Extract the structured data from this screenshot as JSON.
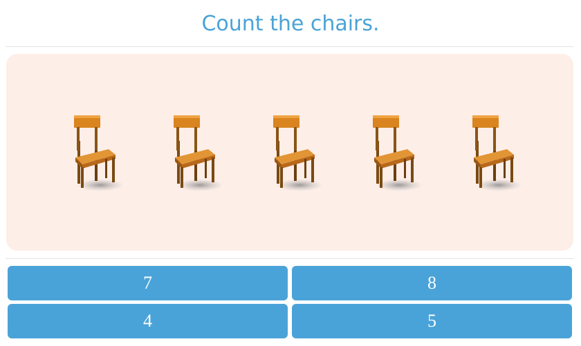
{
  "question": {
    "title": "Count the chairs."
  },
  "stage": {
    "item_icon": "chair-icon",
    "item_count": 5,
    "background_color": "#fdeee8"
  },
  "answers": [
    {
      "label": "7"
    },
    {
      "label": "8"
    },
    {
      "label": "4"
    },
    {
      "label": "5"
    }
  ],
  "colors": {
    "accent": "#4aa3d8",
    "title": "#4aa3d6"
  }
}
